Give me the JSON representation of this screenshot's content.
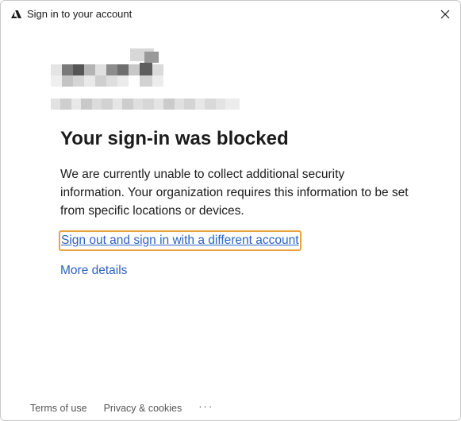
{
  "window": {
    "title": "Sign in to your account",
    "app_icon": "azure-logo-icon",
    "close_icon": "close-icon"
  },
  "content": {
    "logo": "organization-logo",
    "account": "pixelated-email",
    "heading": "Your sign-in was blocked",
    "message": "We are currently unable to collect additional security information. Your organization requires this information to be set from specific locations or devices.",
    "sign_out_link": "Sign out and sign in with a different account",
    "more_details_link": "More details"
  },
  "footer": {
    "terms": "Terms of use",
    "privacy": "Privacy & cookies",
    "more": "···"
  },
  "colors": {
    "link": "#2a63c4",
    "focus_ring": "#e8a33c",
    "text": "#1b1b1b",
    "footer_text": "#555555"
  }
}
